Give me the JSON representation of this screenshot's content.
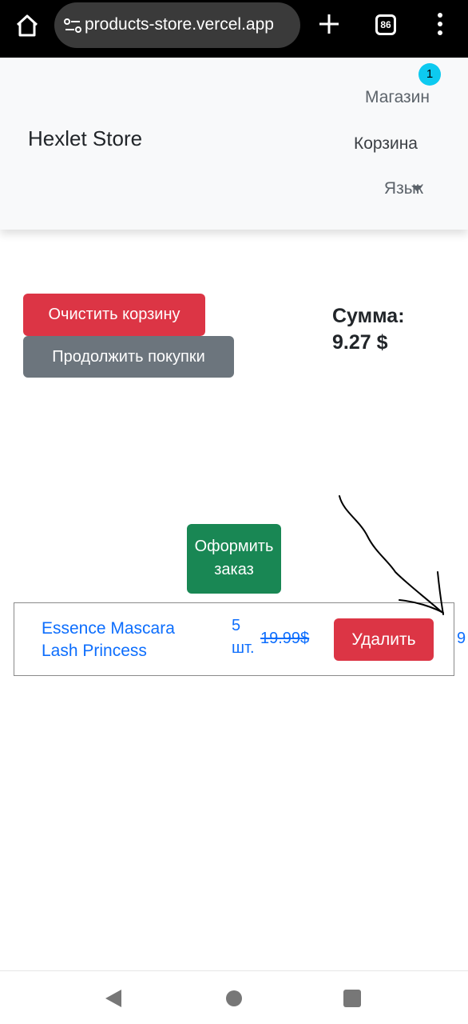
{
  "browser": {
    "url": "products-store.vercel.app",
    "tab_count": "86"
  },
  "header": {
    "brand": "Hexlet Store",
    "nav": {
      "shop": "Магазин",
      "cart": "Корзина",
      "cart_badge": "1",
      "language": "Язык"
    }
  },
  "cart": {
    "clear_label": "Очистить корзину",
    "continue_label": "Продолжить покупки",
    "sum_label": "Сумма:",
    "sum_value": "9.27 $",
    "checkout_label": "Оформить заказ",
    "items": [
      {
        "name": "Essence Mascara Lash Princess",
        "quantity": "5 шт.",
        "old_price": "19.99$",
        "delete_label": "Удалить",
        "new_price": "9"
      }
    ]
  },
  "colors": {
    "danger": "#dc3545",
    "secondary": "#6c757d",
    "success": "#198754",
    "link": "#0d6efd",
    "badge": "#0dcaf0"
  }
}
